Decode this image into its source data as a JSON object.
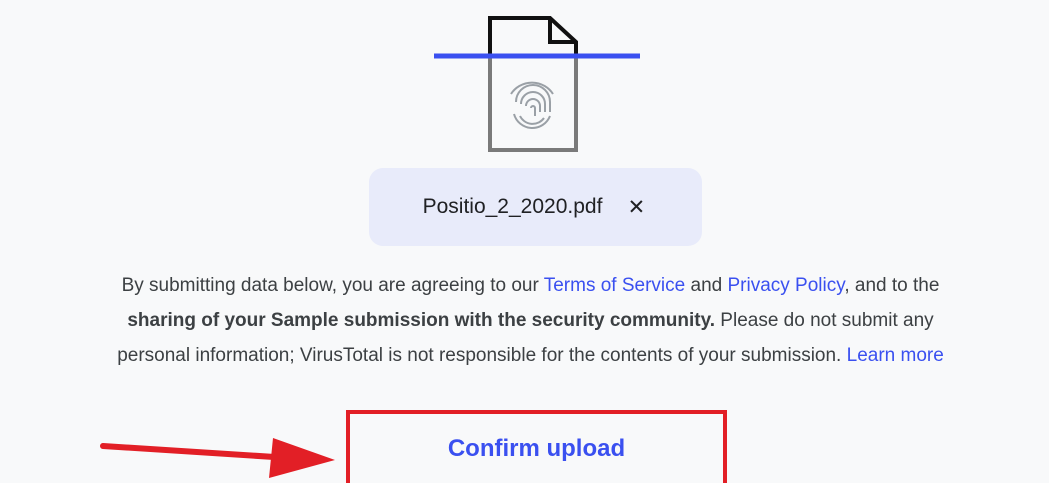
{
  "upload": {
    "file_name": "Positio_2_2020.pdf",
    "remove_symbol": "✕"
  },
  "notice": {
    "part1": "By submitting data below, you are agreeing to our ",
    "terms_link": "Terms of Service",
    "and": " and ",
    "privacy_link": "Privacy Policy",
    "part2": ", and to the",
    "bold_text": "sharing of your Sample submission with the security community.",
    "part3": " Please do not submit any",
    "part4": "personal information; VirusTotal is not responsible for the contents of your submission. ",
    "learn_more_link": "Learn more"
  },
  "actions": {
    "confirm_label": "Confirm upload"
  },
  "colors": {
    "accent": "#3a50f0",
    "highlight_red": "#e21f26",
    "chip_background": "#e8ebfa",
    "page_background": "#f8f9fa"
  },
  "icons": [
    "file-fingerprint-icon",
    "close-icon",
    "red-arrow-annotation"
  ]
}
